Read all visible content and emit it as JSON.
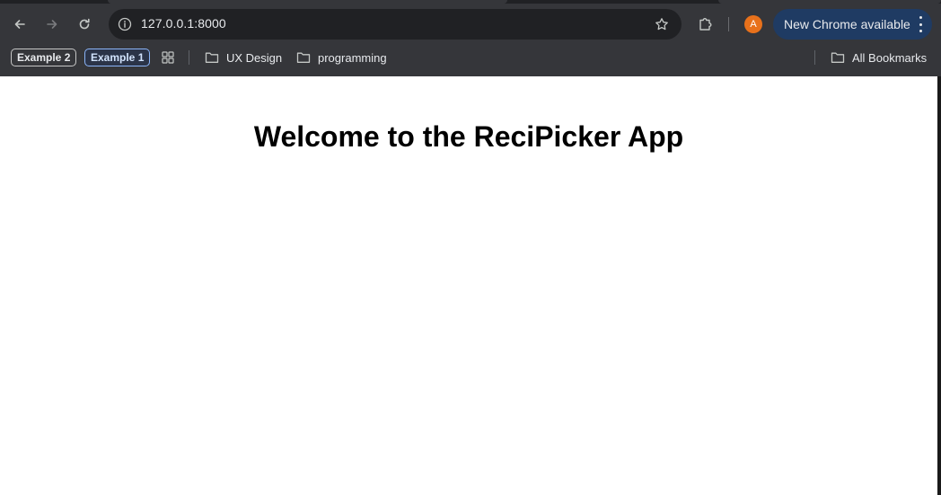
{
  "browser": {
    "url": "127.0.0.1:8000",
    "avatar_letter": "A",
    "update_label": "New Chrome available",
    "colors": {
      "frame": "#35363a",
      "omnibox": "#202124",
      "avatar": "#e8711b",
      "update_pill": "#1f3b63"
    }
  },
  "toolbar": {
    "icons": [
      "back-arrow-icon",
      "forward-arrow-icon",
      "reload-icon",
      "site-info-icon",
      "bookmark-star-icon",
      "extensions-icon",
      "more-vert-icon"
    ]
  },
  "bookmarks": {
    "chips": [
      "Example 2",
      "Example 1"
    ],
    "folders": [
      "UX Design",
      "programming"
    ],
    "all_bookmarks": "All Bookmarks"
  },
  "page": {
    "title": "Welcome to the ReciPicker App"
  }
}
